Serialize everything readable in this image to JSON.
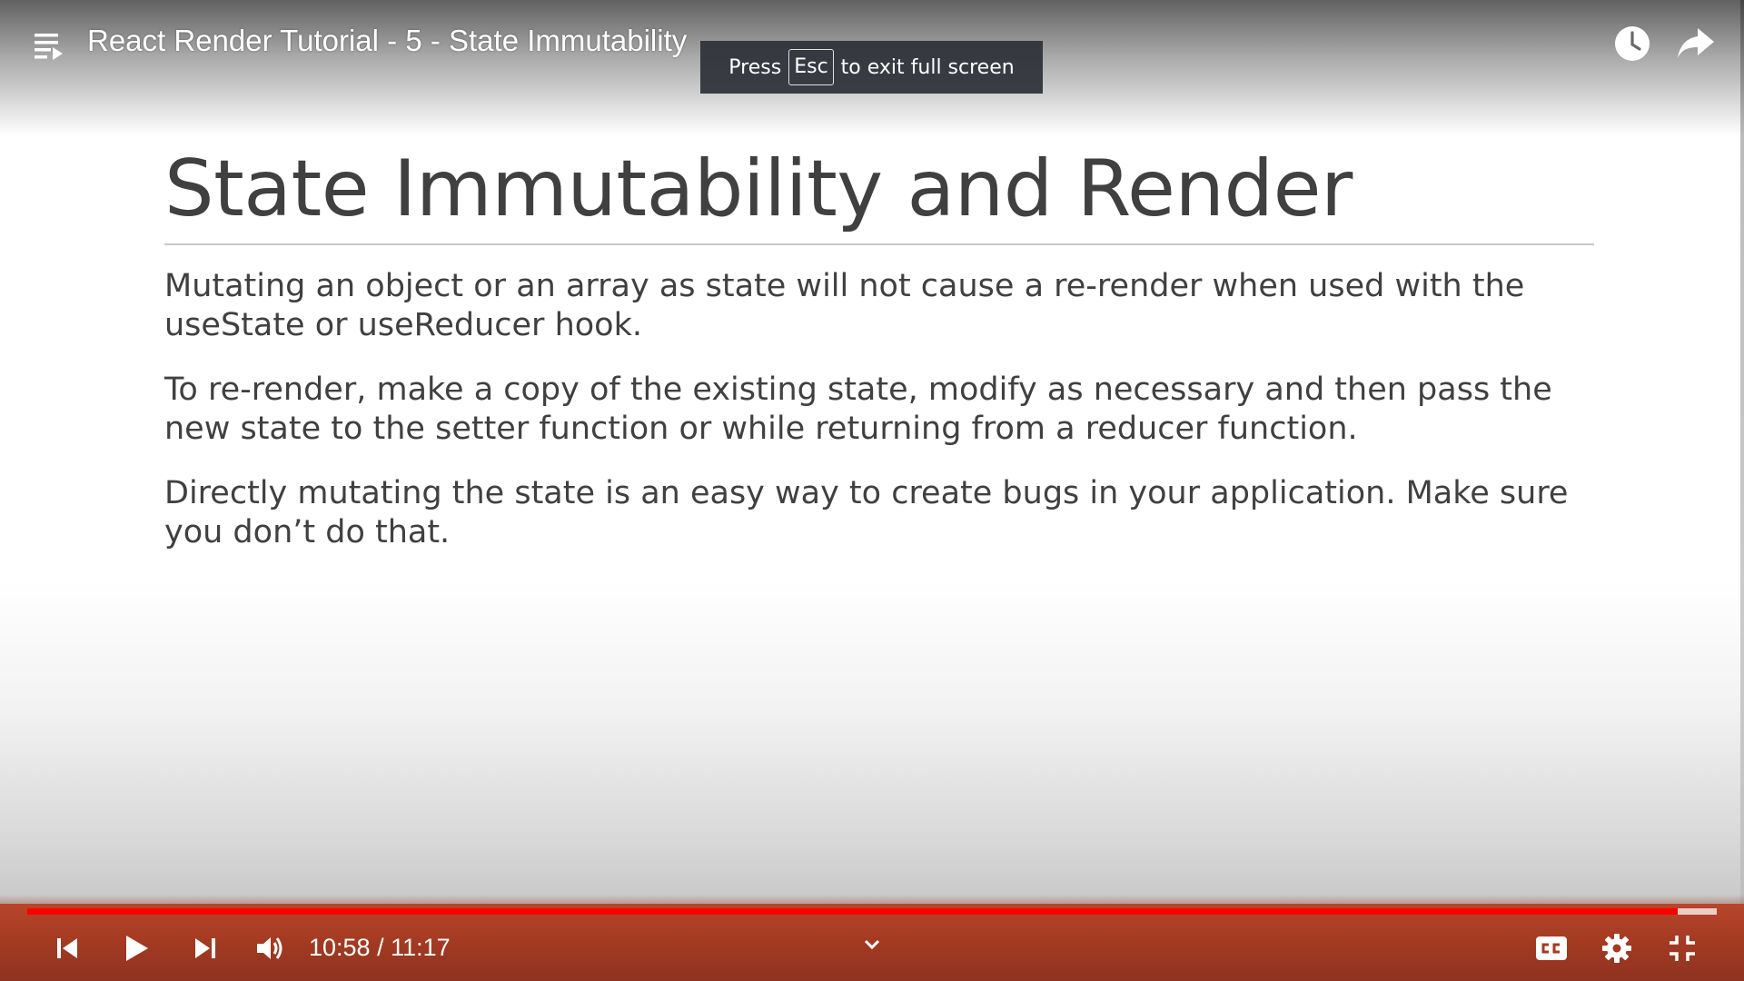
{
  "player": {
    "title": "React Render Tutorial - 5 - State Immutability",
    "fullscreen_hint": {
      "prefix": "Press",
      "key": "Esc",
      "suffix": "to exit full screen"
    },
    "time": {
      "current": "10:58",
      "separator": "/",
      "total": "11:17"
    },
    "progress": {
      "played_fraction": 0.977,
      "buffered_fraction": 1.0
    },
    "colors": {
      "progress": "#ff0000",
      "controls_text": "#ffffff"
    }
  },
  "slide": {
    "title": "State Immutability and Render",
    "paragraphs": [
      "Mutating an object or an array as state will not cause a re-render when used with the useState or useReducer hook.",
      "To re-render, make a copy of the existing state, modify as necessary and then pass the new state to the setter function or while returning from a reducer function.",
      "Directly mutating the state is an easy way to create bugs in your application. Make sure you don’t do that."
    ]
  },
  "icons": {
    "top_left": "playlist-icon",
    "top_right": [
      "watch-later-icon",
      "share-icon"
    ],
    "controls": [
      "previous-icon",
      "play-icon",
      "next-icon",
      "volume-icon",
      "chevron-down-icon",
      "captions-icon",
      "settings-gear-icon",
      "exit-fullscreen-icon"
    ]
  }
}
